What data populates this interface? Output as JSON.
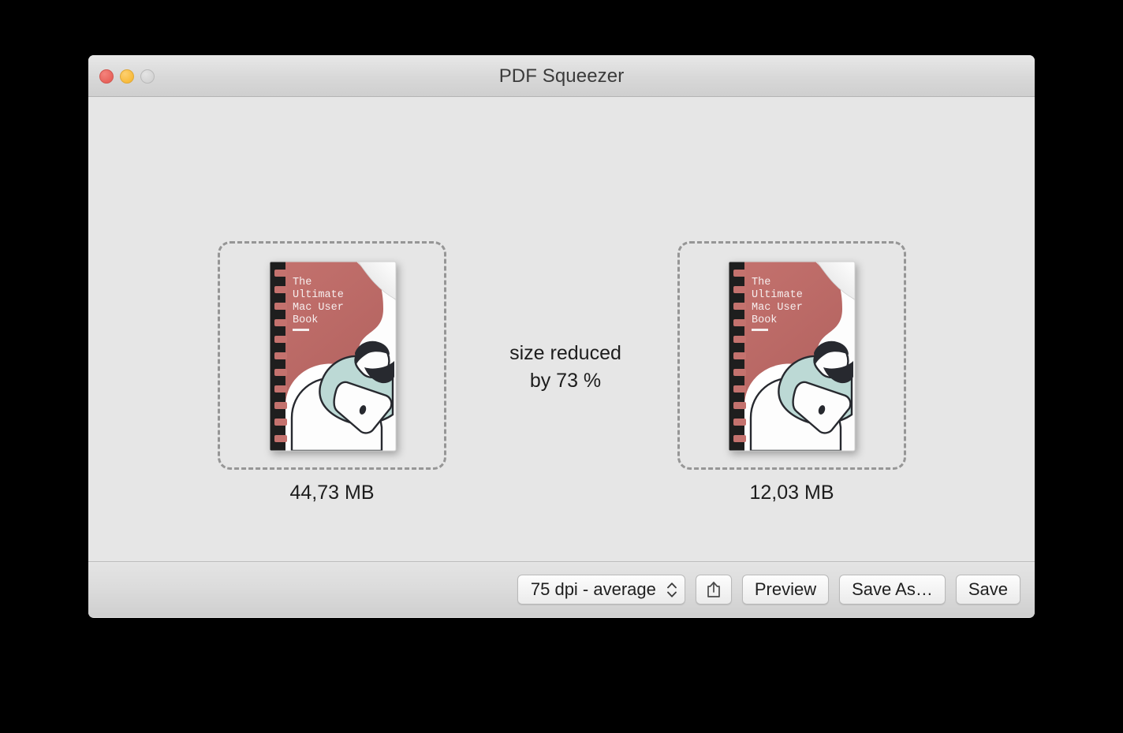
{
  "window": {
    "title": "PDF Squeezer",
    "traffic_lights": [
      {
        "name": "close",
        "color": "#e8635c"
      },
      {
        "name": "minimize",
        "color": "#f8bb3c"
      },
      {
        "name": "zoom",
        "color": "#d4d4d4"
      }
    ]
  },
  "content": {
    "original": {
      "size": "44,73 MB",
      "dropzone_label": "original-pdf-dropzone"
    },
    "compressed": {
      "size": "12,03 MB",
      "dropzone_label": "compressed-pdf-dropzone"
    },
    "reduction": {
      "line1": "size reduced",
      "line2": "by 73 %",
      "percent": 73
    },
    "book_cover": {
      "title_lines": [
        "The",
        "Ultimate",
        "Mac User",
        "Book"
      ],
      "cover_color": "#c4726e",
      "shirt_color": "#bcd9d5",
      "ink_color": "#27292f",
      "paper_color": "#fdfdfd",
      "spine_color": "#1e1e1e"
    }
  },
  "toolbar": {
    "dpi_value": "75 dpi - average",
    "share_label": "share-icon",
    "preview_label": "Preview",
    "save_as_label": "Save As…",
    "save_label": "Save"
  },
  "colors": {
    "window_background": "#e6e6e6",
    "titlebar_top": "#e8e8e8",
    "titlebar_bottom": "#cfcfcf",
    "dashed_border": "#969696",
    "text": "#1d1d1d"
  }
}
